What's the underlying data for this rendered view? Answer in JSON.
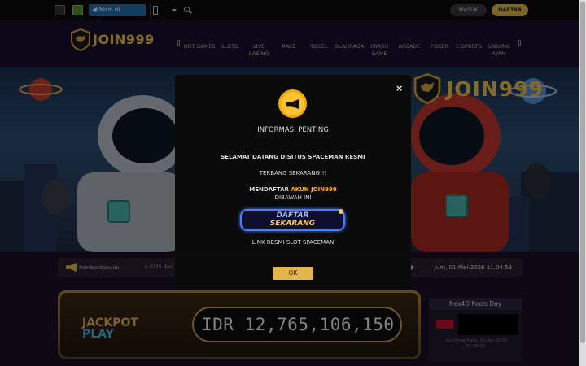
{
  "topbar": {
    "telegram_label": "Main di Telegram",
    "login_label": "MASUK",
    "register_label": "DAFTAR"
  },
  "brand": {
    "name": "JOIN999"
  },
  "nav": {
    "items": [
      {
        "label": "HOT GAMES"
      },
      {
        "label": "SLOTS"
      },
      {
        "label": "LIVE CASINO"
      },
      {
        "label": "RACE"
      },
      {
        "label": "TOGEL"
      },
      {
        "label": "OLAHRAGA"
      },
      {
        "label": "CRASH GAME"
      },
      {
        "label": "ARCADE"
      },
      {
        "label": "POKER"
      },
      {
        "label": "E-SPORTS"
      },
      {
        "label": "SABUNG AYAM"
      }
    ]
  },
  "banner": {
    "brand_text": "JOIN999"
  },
  "announcement": {
    "label": "Pemberitahuan",
    "scroll_text": "s-2025 dari",
    "datetime": "Jum, 01-Mei-2026 11.04.59"
  },
  "jackpot": {
    "label_top": "JACKPOT",
    "label_bottom": "PLAY",
    "value": "IDR 12,765,106,150"
  },
  "pools": {
    "title": "Nex4D Pools Day",
    "draw_text": "Live Draw Kam, 30-Apr-2026 00.00.00"
  },
  "modal": {
    "title": "INFORMASI PENTING",
    "line1": "SELAMAT DATANG DISITUS SPACEMAN RESMI",
    "line2": "TERBANG SEKARANG!!!",
    "line3_pre": "MENDAFTAR ",
    "line3_highlight": "AKUN JOIN999",
    "line4": "DIBAWAH INI",
    "daftar_top": "DAFTAR",
    "daftar_bottom": "SEKARANG",
    "link_text": "LINK RESMI SLOT SPACEMAN",
    "ok_label": "OK",
    "close_glyph": "×"
  },
  "colors": {
    "gold": "#e3b64a",
    "telegram": "#1f6fb5",
    "highlight": "#ffb400"
  }
}
